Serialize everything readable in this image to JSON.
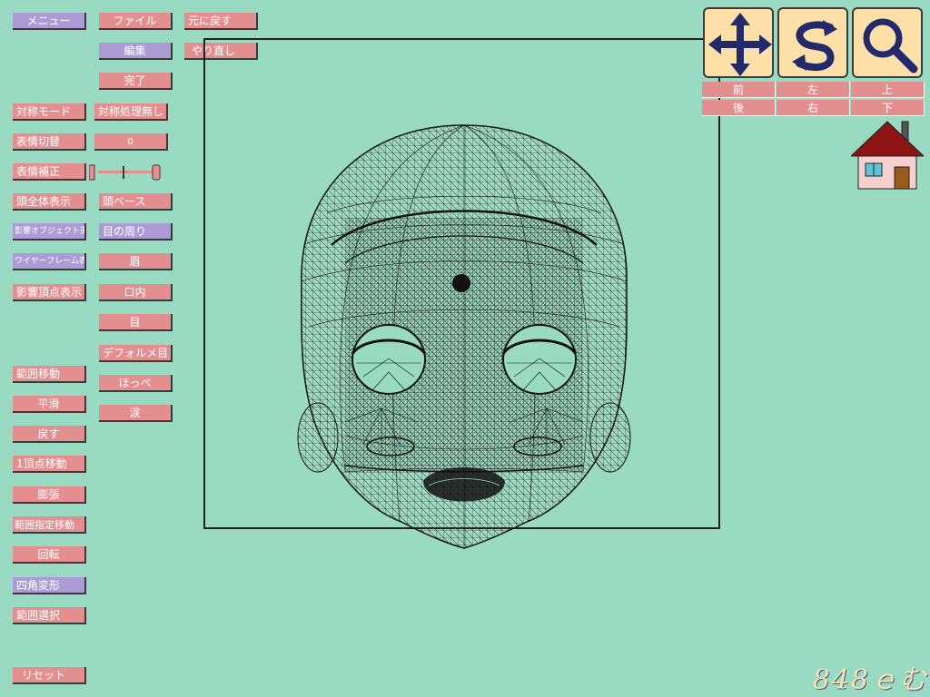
{
  "left_column": {
    "menu": "メニュー",
    "symmetry_mode": "対称モード",
    "expression_switch": "表情切替",
    "expression_fix": "表情補正",
    "head_all": "頭全体表示",
    "affect_object": "影響オブジェクト選択",
    "wireframe": "ワイヤーフレーム表示",
    "affect_vertex": "影響頂点表示",
    "range_move": "範囲移動",
    "smooth": "平滑",
    "revert": "戻す",
    "vertex_move": "1頂点移動",
    "expand": "膨張",
    "range_spec_move": "範囲指定移動",
    "rotate": "回転",
    "quad_deform": "四角変形",
    "range_select": "範囲選択",
    "reset": "リセット"
  },
  "middle_column": {
    "file": "ファイル",
    "edit": "編集",
    "done": "完了",
    "no_symmetry": "対称処理無し",
    "expression_index": "0",
    "head_base": "頭ベース",
    "around_eyes": "目の周り",
    "brow": "眉",
    "mouth_inside": "口内",
    "eye": "目",
    "deformed_eye": "デフォルメ目",
    "cheek": "ほっぺ",
    "tears": "涙"
  },
  "top_row": {
    "undo": "元に戻す",
    "redo": "やり直し"
  },
  "view_tools": {
    "move": "move-arrows-icon",
    "rotate": "rotate-arrows-icon",
    "zoom": "magnifier-icon"
  },
  "directions": {
    "front": "前",
    "left": "左",
    "up": "上",
    "back": "後",
    "right": "右",
    "down": "下"
  },
  "home_icon": "house-icon",
  "logo_text": "848ｅむ",
  "colors": {
    "background": "#99dbc2",
    "pink_button": "#e38f8f",
    "purple_button": "#ad9bd6",
    "tool_bg": "#fce0a8"
  }
}
